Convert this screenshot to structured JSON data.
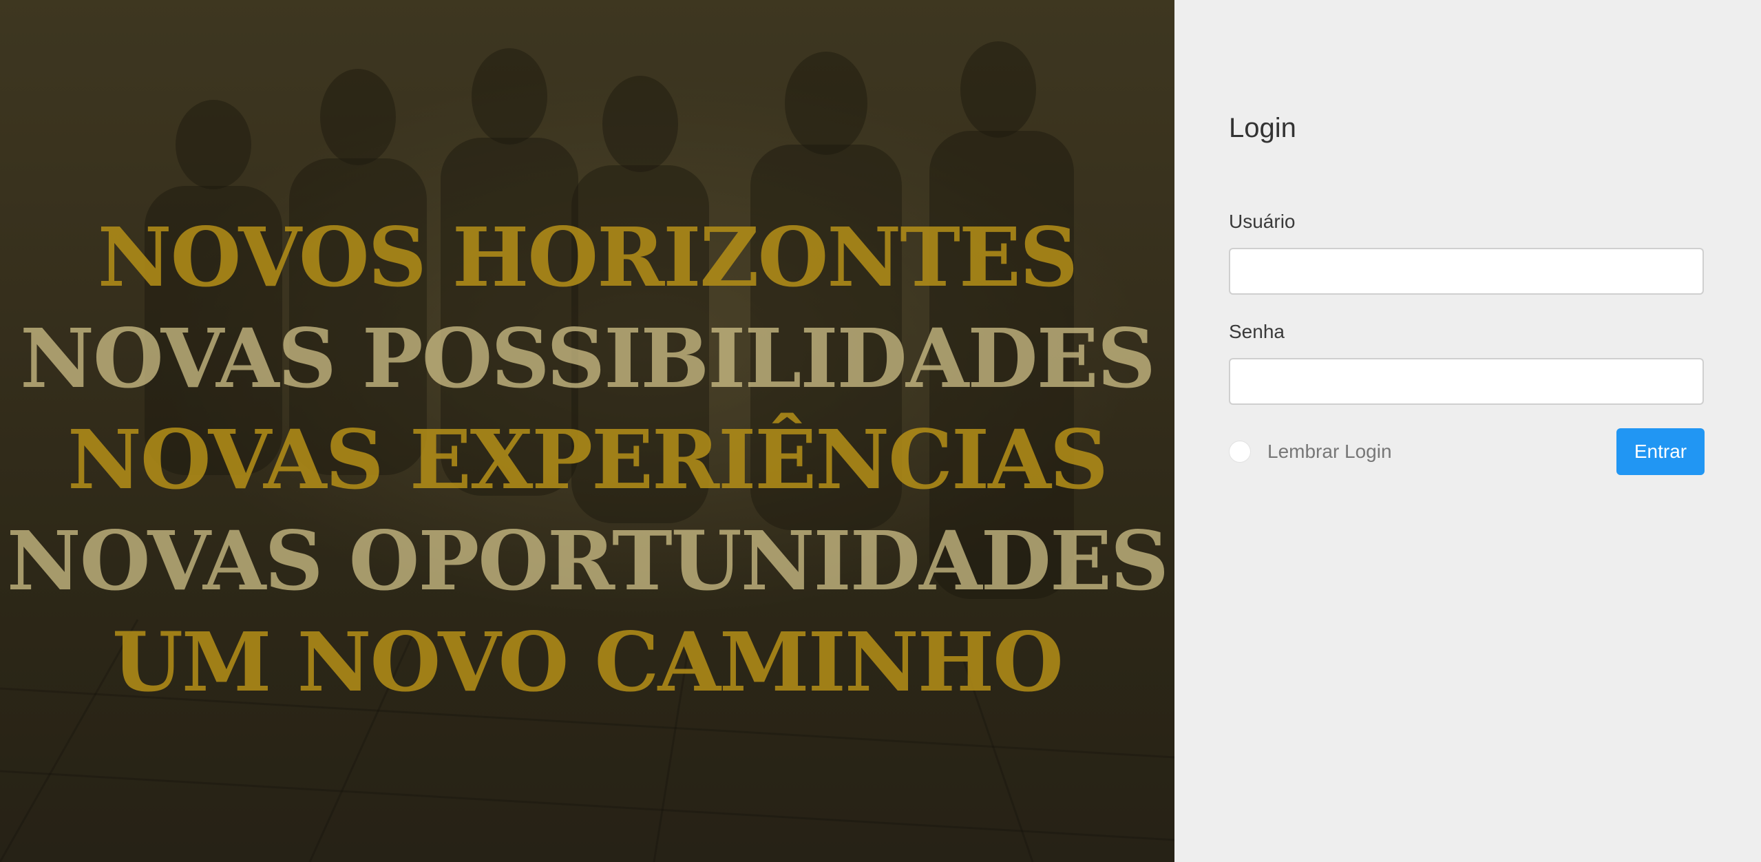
{
  "hero": {
    "lines": [
      "NOVOS HORIZONTES",
      "NOVAS POSSIBILIDADES",
      "NOVAS EXPERIÊNCIAS",
      "NOVAS OPORTUNIDADES",
      "UM NOVO CAMINHO"
    ],
    "colors": {
      "gold": "#b08c18",
      "sand": "#d6c68c",
      "tint": "#3c3522"
    }
  },
  "login": {
    "title": "Login",
    "username_label": "Usuário",
    "username_value": "",
    "password_label": "Senha",
    "password_value": "",
    "remember_label": "Lembrar Login",
    "submit_label": "Entrar",
    "accent_color": "#2196f3",
    "panel_color": "#eeeeee"
  }
}
